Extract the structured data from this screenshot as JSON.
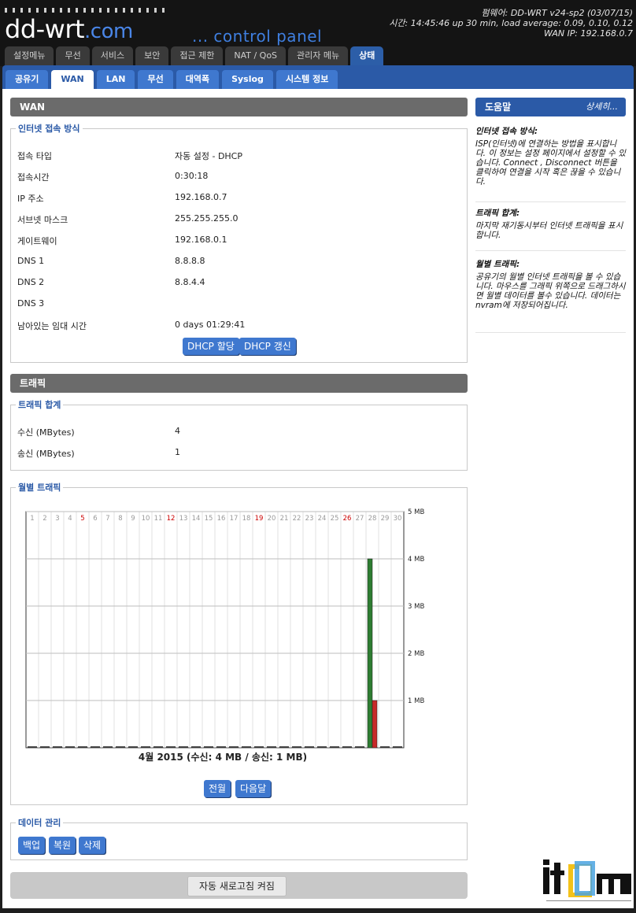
{
  "header": {
    "logo_main": "dd-wrt",
    "logo_suffix": ".com",
    "subtitle": "... control panel",
    "firmware": "펌웨어: DD-WRT v24-sp2 (03/07/15)",
    "time": "시간: 14:45:46 up 30 min, load average: 0.09, 0.10, 0.12",
    "wan_ip": "WAN IP: 192.168.0.7"
  },
  "main_tabs": [
    {
      "label": "설정메뉴",
      "active": false
    },
    {
      "label": "무선",
      "active": false
    },
    {
      "label": "서비스",
      "active": false
    },
    {
      "label": "보안",
      "active": false
    },
    {
      "label": "접근 제한",
      "active": false
    },
    {
      "label": "NAT / QoS",
      "active": false
    },
    {
      "label": "관리자 메뉴",
      "active": false
    },
    {
      "label": "상태",
      "active": true
    }
  ],
  "sub_tabs": [
    {
      "label": "공유기",
      "active": false
    },
    {
      "label": "WAN",
      "active": true
    },
    {
      "label": "LAN",
      "active": false
    },
    {
      "label": "무선",
      "active": false
    },
    {
      "label": "대역폭",
      "active": false
    },
    {
      "label": "Syslog",
      "active": false
    },
    {
      "label": "시스템 정보",
      "active": false
    }
  ],
  "wan": {
    "section_title": "WAN",
    "legend": "인터넷 접속 방식",
    "rows": [
      {
        "label": "접속 타입",
        "value": "자동 설정 - DHCP"
      },
      {
        "label": "접속시간",
        "value": "0:30:18"
      },
      {
        "label": "IP 주소",
        "value": "192.168.0.7"
      },
      {
        "label": "서브넷 마스크",
        "value": "255.255.255.0"
      },
      {
        "label": "게이트웨이",
        "value": "192.168.0.1"
      },
      {
        "label": "DNS 1",
        "value": "8.8.8.8"
      },
      {
        "label": "DNS 2",
        "value": "8.8.4.4"
      },
      {
        "label": "DNS 3",
        "value": ""
      },
      {
        "label": "남아있는 임대 시간",
        "value": "0 days 01:29:41"
      }
    ],
    "btn_release": "DHCP 할당",
    "btn_renew": "DHCP 갱신"
  },
  "traffic": {
    "section_title": "트래픽",
    "legend_total": "트래픽 합계",
    "rows": [
      {
        "label": "수신 (MBytes)",
        "value": "4"
      },
      {
        "label": "송신 (MBytes)",
        "value": "1"
      }
    ],
    "legend_monthly": "월별 트래픽",
    "caption": "4월 2015 (수신: 4 MB / 송신: 1 MB)",
    "btn_prev": "전월",
    "btn_next": "다음달"
  },
  "data_mgmt": {
    "legend": "데이터 관리",
    "btn_backup": "백업",
    "btn_restore": "복원",
    "btn_delete": "삭제"
  },
  "refresh_label": "자동 새로고침 켜짐",
  "help": {
    "title": "도움말",
    "more": "상세히...",
    "blocks": [
      {
        "title": "인터넷 접속 방식:",
        "text": "ISP(인터넷)에 연결하는 방법을 표시합니다. 이 정보는 설정 페이지에서 설정할 수 있습니다. Connect , Disconnect 버튼을 클릭하여 연결을 시작 혹은 끊을 수 있습니다."
      },
      {
        "title": "트래픽 합계:",
        "text": "마지막 재기동시부터 인터넷 트래픽을 표시합니다."
      },
      {
        "title": "월별 트래픽:",
        "text": "공유기의 월별 인터넷 트래픽을 볼 수 있습니다. 마우스를 그래픽 위쪽으로 드래그하시면 월별 데이터를 볼수 있습니다. 데이터는 nvram에 저장되어집니다."
      }
    ]
  },
  "colors": {
    "incoming": "#2e7d32",
    "outgoing": "#c62828",
    "accent": "#2b5aa7"
  },
  "chart_data": {
    "type": "bar",
    "categories": [
      "1",
      "2",
      "3",
      "4",
      "5",
      "6",
      "7",
      "8",
      "9",
      "10",
      "11",
      "12",
      "13",
      "14",
      "15",
      "16",
      "17",
      "18",
      "19",
      "20",
      "21",
      "22",
      "23",
      "24",
      "25",
      "26",
      "27",
      "28",
      "29",
      "30"
    ],
    "red_days": [
      "5",
      "12",
      "19",
      "26"
    ],
    "series": [
      {
        "values": [
          0,
          0,
          0,
          0,
          0,
          0,
          0,
          0,
          0,
          0,
          0,
          0,
          0,
          0,
          0,
          0,
          0,
          0,
          0,
          0,
          0,
          0,
          0,
          0,
          0,
          0,
          0,
          4,
          0,
          0
        ]
      },
      {
        "values": [
          0,
          0,
          0,
          0,
          0,
          0,
          0,
          0,
          0,
          0,
          0,
          0,
          0,
          0,
          0,
          0,
          0,
          0,
          0,
          0,
          0,
          0,
          0,
          0,
          0,
          0,
          0,
          1,
          0,
          0
        ]
      }
    ],
    "y_ticks": [
      "1 MB",
      "2 MB",
      "3 MB",
      "4 MB",
      "5 MB"
    ],
    "ylim": [
      0,
      5
    ]
  },
  "watermark": "itcm"
}
